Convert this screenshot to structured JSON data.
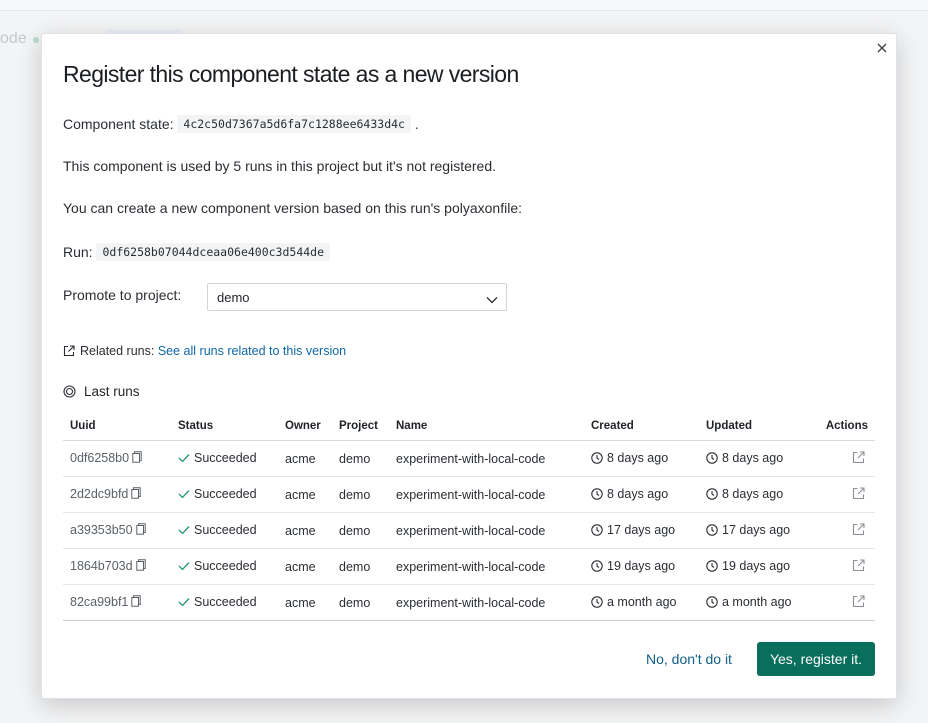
{
  "background": {
    "crumb_text": "ode"
  },
  "modal": {
    "title": "Register this component state as a new version",
    "state_label": "Component state:",
    "state_hash": "4c2c50d7367a5d6fa7c1288ee6433d4c",
    "state_suffix": ".",
    "usage_text": "This component is used by 5 runs in this project but it's not registered.",
    "create_text": "You can create a new component version based on this run's polyaxonfile:",
    "run_label": "Run:",
    "run_hash": "0df6258b07044dceaa06e400c3d544de",
    "promote_label": "Promote to project:",
    "promote_value": "demo",
    "related_label": "Related runs:",
    "related_link": "See all runs related to this version",
    "last_runs_title": "Last runs",
    "table": {
      "headers": [
        "Uuid",
        "Status",
        "Owner",
        "Project",
        "Name",
        "Created",
        "Updated",
        "Actions"
      ],
      "rows": [
        {
          "uuid": "0df6258b0",
          "status": "Succeeded",
          "owner": "acme",
          "project": "demo",
          "name": "experiment-with-local-code",
          "created": "8 days ago",
          "updated": "8 days ago"
        },
        {
          "uuid": "2d2dc9bfd",
          "status": "Succeeded",
          "owner": "acme",
          "project": "demo",
          "name": "experiment-with-local-code",
          "created": "8 days ago",
          "updated": "8 days ago"
        },
        {
          "uuid": "a39353b50",
          "status": "Succeeded",
          "owner": "acme",
          "project": "demo",
          "name": "experiment-with-local-code",
          "created": "17 days ago",
          "updated": "17 days ago"
        },
        {
          "uuid": "1864b703d",
          "status": "Succeeded",
          "owner": "acme",
          "project": "demo",
          "name": "experiment-with-local-code",
          "created": "19 days ago",
          "updated": "19 days ago"
        },
        {
          "uuid": "82ca99bf1",
          "status": "Succeeded",
          "owner": "acme",
          "project": "demo",
          "name": "experiment-with-local-code",
          "created": "a month ago",
          "updated": "a month ago"
        }
      ]
    },
    "cancel_label": "No, don't do it",
    "confirm_label": "Yes, register it."
  },
  "colors": {
    "accent": "#0a6e5c",
    "link": "#1168a8",
    "success": "#1f9d6b"
  }
}
